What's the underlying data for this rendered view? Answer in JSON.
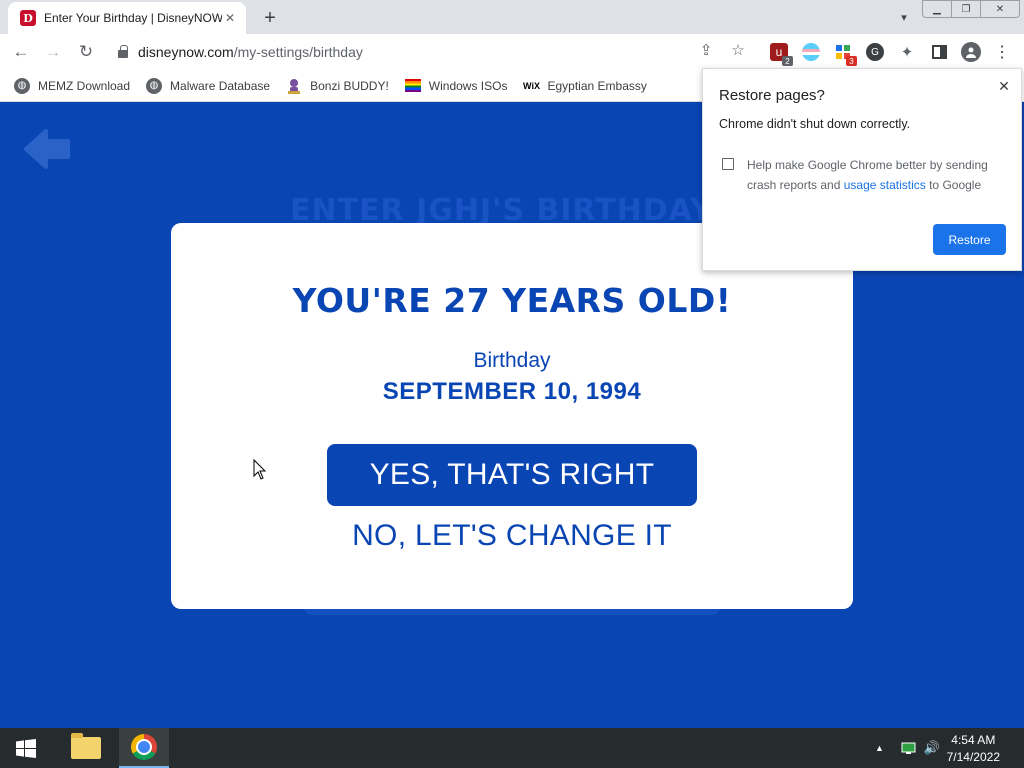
{
  "browser": {
    "tab": {
      "title": "Enter Your Birthday | DisneyNOW",
      "favicon": "disney-d-icon"
    },
    "url": {
      "host": "disneynow.com",
      "path": "/my-settings/birthday"
    },
    "bookmarks": [
      {
        "label": "MEMZ Download",
        "icon": "globe-icon"
      },
      {
        "label": "Malware Database",
        "icon": "globe-icon"
      },
      {
        "label": "Bonzi BUDDY!",
        "icon": "bonzi-icon"
      },
      {
        "label": "Windows ISOs",
        "icon": "rainbow-flag-icon"
      },
      {
        "label": "Egyptian Embassy",
        "icon": "wix-icon",
        "icon_text": "WiX"
      }
    ],
    "extensions": [
      {
        "name": "ublock-icon",
        "badge": "2",
        "badge_color": "#5f6368"
      },
      {
        "name": "pride-flag-icon"
      },
      {
        "name": "apps-extension-icon",
        "badge": "3",
        "badge_color": "#d93025"
      },
      {
        "name": "grammar-extension-icon"
      },
      {
        "name": "puzzle-extensions-icon"
      }
    ]
  },
  "page": {
    "background_heading": "ENTER JGHJ'S BIRTHDAY",
    "age_heading": "YOU'RE 27 YEARS OLD!",
    "birthday_label": "Birthday",
    "birthday_date": "SEPTEMBER 10, 1994",
    "confirm_label": "YES, THAT'S RIGHT",
    "change_label": "NO, LET'S CHANGE IT",
    "colors": {
      "brand_blue": "#0a45b4",
      "card": "#ffffff"
    }
  },
  "restore_popup": {
    "title": "Restore pages?",
    "message": "Chrome didn't shut down correctly.",
    "help_prefix": "Help make Google Chrome better by sending crash reports and ",
    "help_link": "usage statistics",
    "help_suffix": " to Google",
    "checked": false,
    "restore_label": "Restore",
    "accent": "#1a73e8"
  },
  "taskbar": {
    "time": "4:54 AM",
    "date": "7/14/2022",
    "apps": [
      "file-explorer-icon",
      "chrome-icon"
    ]
  }
}
